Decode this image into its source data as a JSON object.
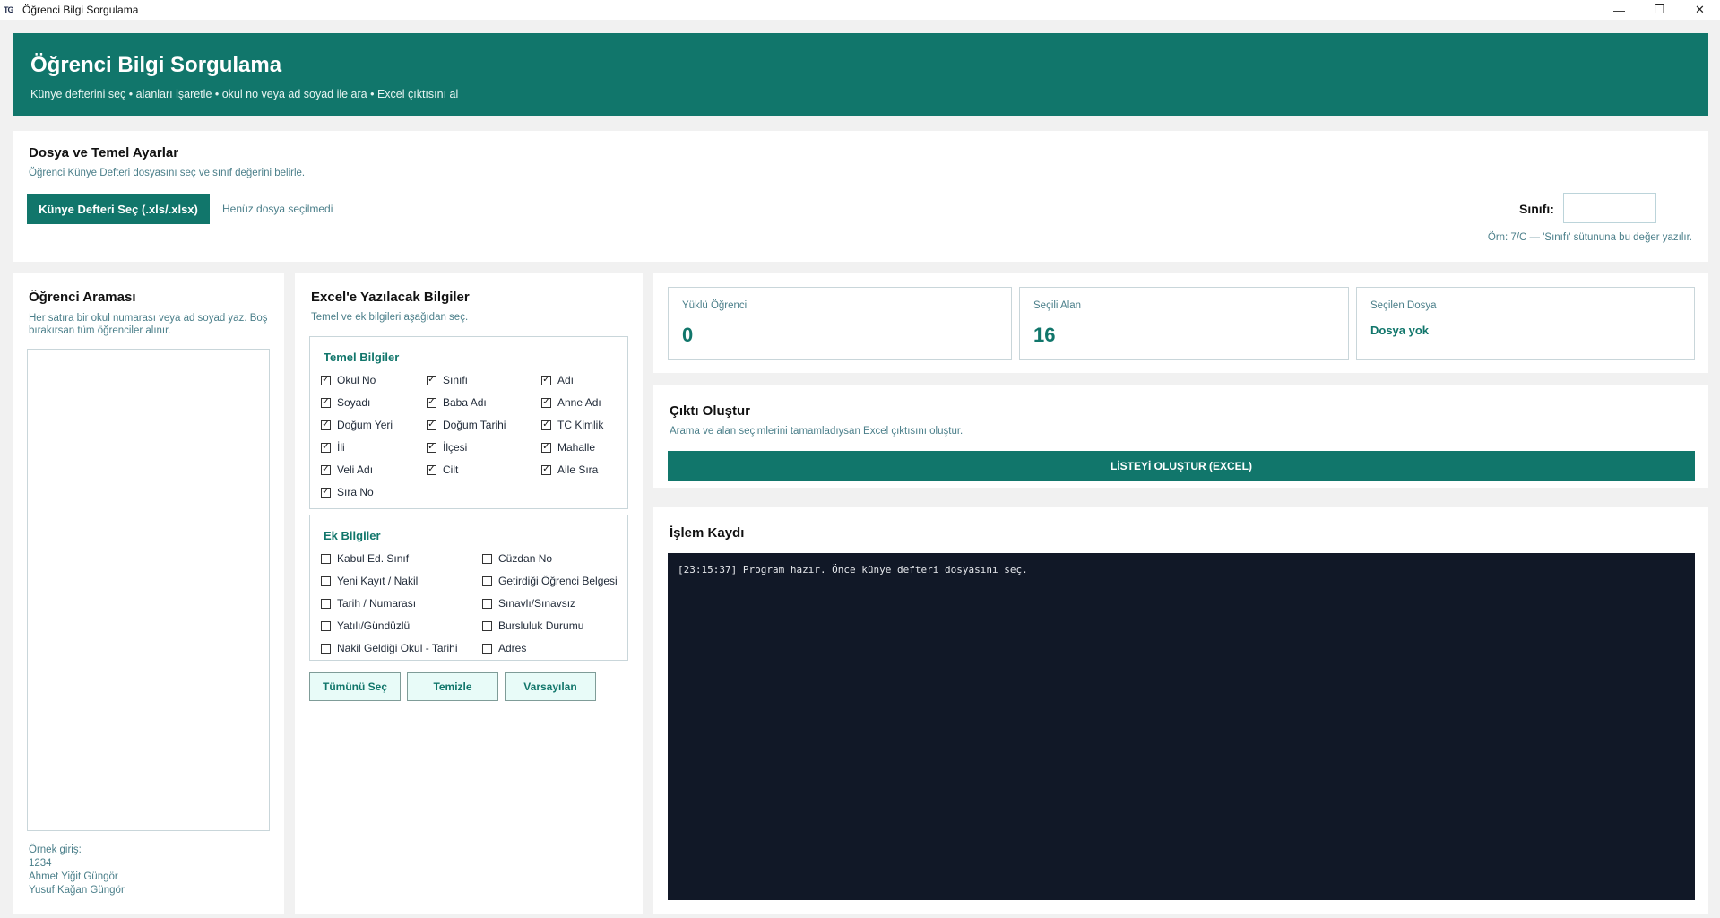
{
  "window": {
    "icon_text": "TG",
    "title": "Öğrenci Bilgi Sorgulama",
    "controls": [
      "—",
      "❐",
      "✕"
    ]
  },
  "header": {
    "title": "Öğrenci Bilgi Sorgulama",
    "subtitle": "Künye defterini seç • alanları işaretle • okul no veya ad soyad ile ara • Excel çıktısını al"
  },
  "file_section": {
    "title": "Dosya ve Temel Ayarlar",
    "description": "Öğrenci Künye Defteri dosyasını seç ve sınıf değerini belirle.",
    "choose_button": "Künye Defteri Seç (.xls/.xlsx)",
    "file_status": "Henüz dosya seçilmedi",
    "class_label": "Sınıfı:",
    "class_value": "",
    "class_hint": "Örn: 7/C — 'Sınıfı' sütununa bu değer yazılır."
  },
  "search_section": {
    "title": "Öğrenci Araması",
    "description": "Her satıra bir okul numarası veya ad soyad yaz. Boş bırakırsan tüm öğrenciler alınır.",
    "value": "",
    "example_lines": [
      "Örnek giriş:",
      "1234",
      "Ahmet Yiğit Güngör",
      "Yusuf Kağan Güngör"
    ]
  },
  "fields_section": {
    "title": "Excel'e Yazılacak Bilgiler",
    "description": "Temel ve ek bilgileri aşağıdan seç.",
    "basic": {
      "title": "Temel Bilgiler",
      "items": [
        {
          "label": "Okul No",
          "checked": true
        },
        {
          "label": "Sınıfı",
          "checked": true
        },
        {
          "label": "Adı",
          "checked": true
        },
        {
          "label": "Soyadı",
          "checked": true
        },
        {
          "label": "Baba Adı",
          "checked": true
        },
        {
          "label": "Anne Adı",
          "checked": true
        },
        {
          "label": "Doğum Yeri",
          "checked": true
        },
        {
          "label": "Doğum Tarihi",
          "checked": true
        },
        {
          "label": "TC Kimlik",
          "checked": true
        },
        {
          "label": "İli",
          "checked": true
        },
        {
          "label": "İlçesi",
          "checked": true
        },
        {
          "label": "Mahalle",
          "checked": true
        },
        {
          "label": "Veli Adı",
          "checked": true
        },
        {
          "label": "Cilt",
          "checked": true
        },
        {
          "label": "Aile Sıra",
          "checked": true
        },
        {
          "label": "Sıra No",
          "checked": true
        }
      ]
    },
    "extra": {
      "title": "Ek Bilgiler",
      "items": [
        {
          "label": "Kabul Ed. Sınıf",
          "checked": false
        },
        {
          "label": "Cüzdan No",
          "checked": false
        },
        {
          "label": "Yeni Kayıt / Nakil",
          "checked": false
        },
        {
          "label": "Getirdiği Öğrenci Belgesi",
          "checked": false
        },
        {
          "label": "Tarih / Numarası",
          "checked": false
        },
        {
          "label": "Sınavlı/Sınavsız",
          "checked": false
        },
        {
          "label": "Yatılı/Gündüzlü",
          "checked": false
        },
        {
          "label": "Bursluluk Durumu",
          "checked": false
        },
        {
          "label": "Nakil Geldiği Okul - Tarihi",
          "checked": false
        },
        {
          "label": "Adres",
          "checked": false
        }
      ]
    },
    "buttons": {
      "select_all": "Tümünü Seç",
      "clear": "Temizle",
      "defaults": "Varsayılan"
    }
  },
  "stats": {
    "loaded_label": "Yüklü Öğrenci",
    "loaded_value": "0",
    "selected_label": "Seçili Alan",
    "selected_value": "16",
    "file_label": "Seçilen Dosya",
    "file_value": "Dosya yok"
  },
  "output_section": {
    "title": "Çıktı Oluştur",
    "description": "Arama ve alan seçimlerini tamamladıysan Excel çıktısını oluştur.",
    "generate_button": "LİSTEYİ OLUŞTUR (EXCEL)"
  },
  "log_section": {
    "title": "İşlem Kaydı",
    "lines": [
      "[23:15:37] Program hazır. Önce künye defteri dosyasını seç."
    ]
  },
  "colors": {
    "accent": "#11766b",
    "log_background": "#111827",
    "muted_text": "#4b7f8a"
  }
}
